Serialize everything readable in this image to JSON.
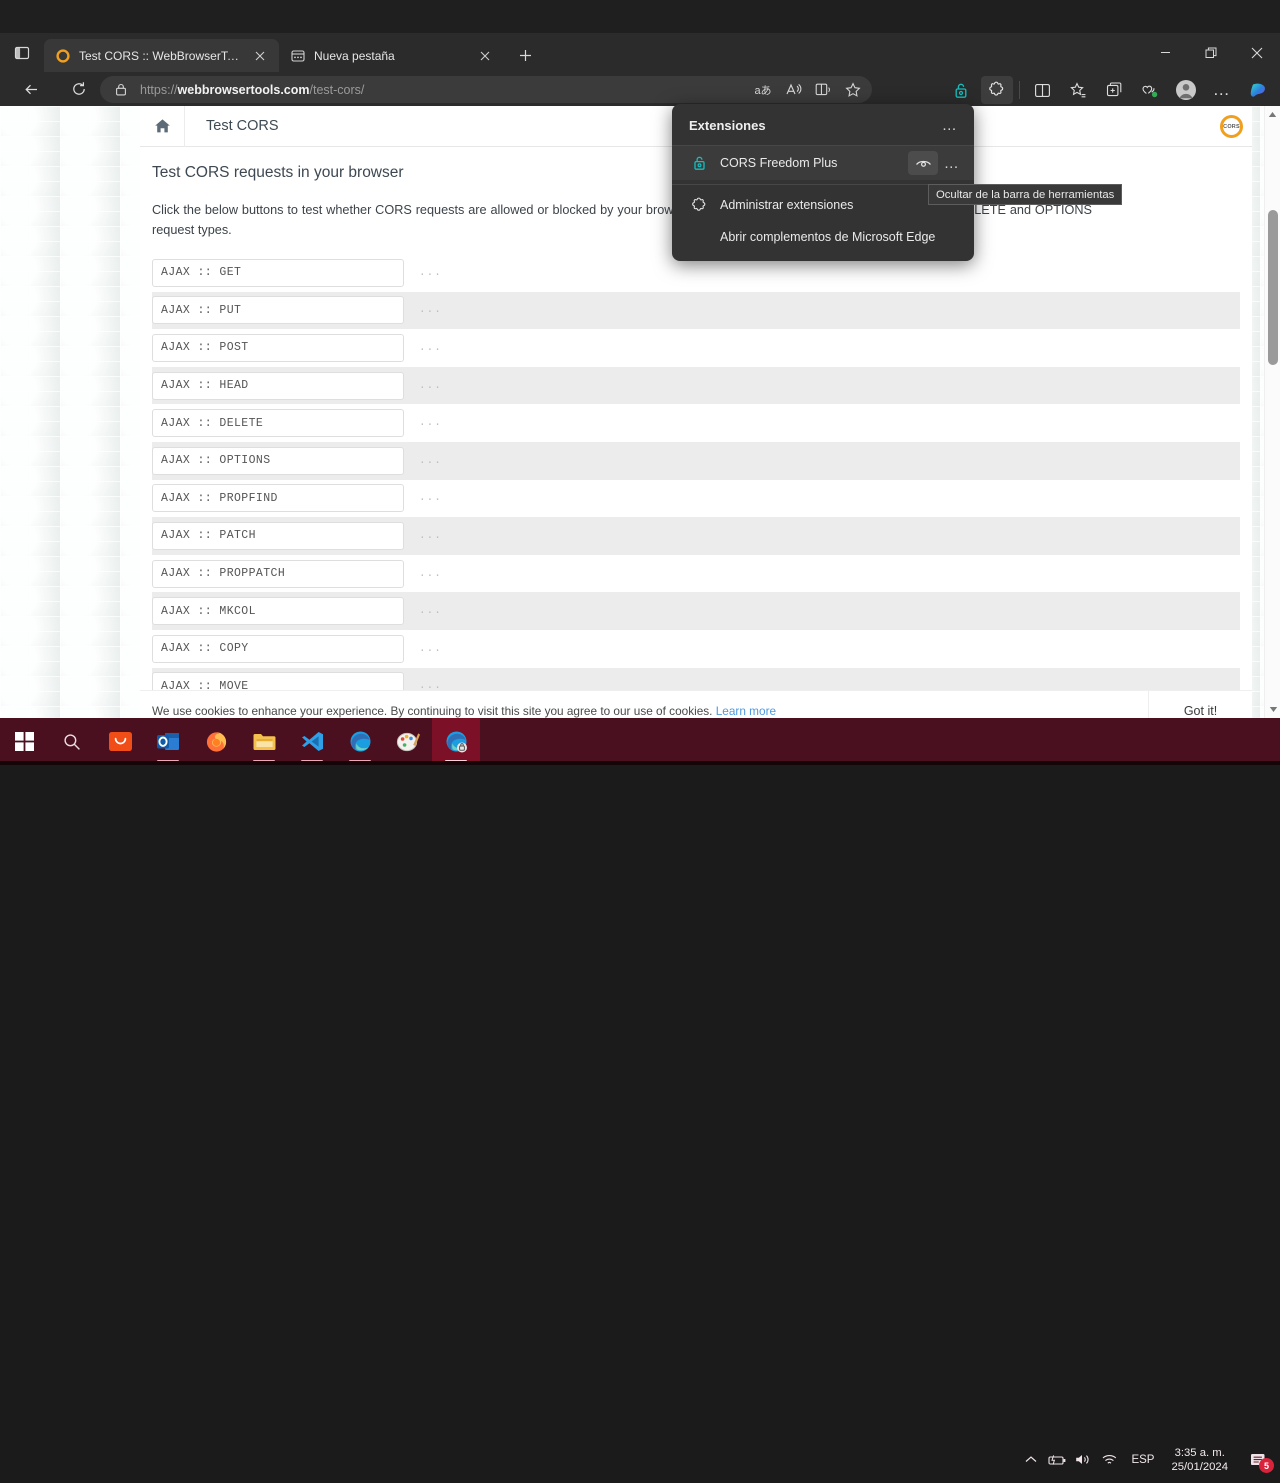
{
  "browser": {
    "tab_search_icon": "tab-search-icon",
    "tabs": [
      {
        "title": "Test CORS :: WebBrowserTools",
        "favicon": "cors-ring-favicon",
        "active": true
      },
      {
        "title": "Nueva pestaña",
        "favicon": "new-tab-page-icon",
        "active": false
      }
    ],
    "new_tab_label": "+",
    "window_controls": {
      "minimize": "minimize-icon",
      "restore": "restore-icon",
      "close": "close-icon"
    },
    "nav": {
      "back": "back-arrow-icon",
      "refresh": "refresh-icon"
    },
    "omnibox": {
      "lock_icon": "lock-icon",
      "url_scheme": "https://",
      "url_domain": "webbrowsertools.com",
      "url_path": "/test-cors/",
      "actions": [
        "translate-icon",
        "read-aloud-icon",
        "immersive-reader-icon",
        "add-favorite-icon"
      ]
    },
    "toolbar_right": [
      {
        "name": "cors-freedom-plus-extension-icon",
        "label": "CORS Freedom Plus"
      },
      {
        "name": "extensions-puzzle-icon",
        "label": "Extensiones"
      },
      {
        "name": "split-screen-icon",
        "label": "Pantalla dividida"
      },
      {
        "name": "collections-icon",
        "label": "Colecciones"
      },
      {
        "name": "browser-essentials-icon",
        "label": "Elementos esenciales del explorador"
      },
      {
        "name": "profile-avatar-icon",
        "label": "Perfil"
      },
      {
        "name": "settings-more-icon",
        "label": "Configuración y más"
      },
      {
        "name": "copilot-icon",
        "label": "Copilot"
      }
    ]
  },
  "extensions_panel": {
    "title": "Extensiones",
    "header_more": "…",
    "items": [
      {
        "label": "CORS Freedom Plus",
        "icon": "teal-padlock-icon",
        "eye_icon": "hide-eye-icon",
        "more": "…"
      }
    ],
    "manage_label": "Administrar extensiones",
    "manage_icon": "puzzle-piece-icon",
    "store_label": "Abrir complementos de Microsoft Edge",
    "tooltip": "Ocultar de la barra de herramientas"
  },
  "page": {
    "home_icon": "home-icon",
    "header_title": "Test CORS",
    "logo_text": "CORS",
    "heading": "Test CORS requests in your browser",
    "intro": "Click the below buttons to test whether CORS requests are allowed or blocked by your browser. This page supports GET, PUT, POST, HEAD, DELETE and OPTIONS request types.",
    "rows": [
      {
        "label": "AJAX :: GET",
        "status": "..."
      },
      {
        "label": "AJAX :: PUT",
        "status": "..."
      },
      {
        "label": "AJAX :: POST",
        "status": "..."
      },
      {
        "label": "AJAX :: HEAD",
        "status": "..."
      },
      {
        "label": "AJAX :: DELETE",
        "status": "..."
      },
      {
        "label": "AJAX :: OPTIONS",
        "status": "..."
      },
      {
        "label": "AJAX :: PROPFIND",
        "status": "..."
      },
      {
        "label": "AJAX :: PATCH",
        "status": "..."
      },
      {
        "label": "AJAX :: PROPPATCH",
        "status": "..."
      },
      {
        "label": "AJAX :: MKCOL",
        "status": "..."
      },
      {
        "label": "AJAX :: COPY",
        "status": "..."
      },
      {
        "label": "AJAX :: MOVE",
        "status": "..."
      }
    ],
    "cookie": {
      "text": "We use cookies to enhance your experience. By continuing to visit this site you agree to our use of cookies.",
      "link": "Learn more",
      "button": "Got it!"
    }
  },
  "taskbar": {
    "items": [
      {
        "name": "start-button",
        "icon": "windows-logo-icon"
      },
      {
        "name": "search-button",
        "icon": "search-icon"
      },
      {
        "name": "taskbar-shopping-app",
        "icon": "orange-bag-icon"
      },
      {
        "name": "taskbar-outlook",
        "icon": "outlook-icon"
      },
      {
        "name": "taskbar-firefox",
        "icon": "firefox-icon"
      },
      {
        "name": "taskbar-file-explorer",
        "icon": "folder-icon"
      },
      {
        "name": "taskbar-vscode",
        "icon": "vscode-icon"
      },
      {
        "name": "taskbar-edge",
        "icon": "edge-icon"
      },
      {
        "name": "taskbar-paint",
        "icon": "paint-icon"
      },
      {
        "name": "taskbar-edge-active",
        "icon": "edge-icon"
      }
    ],
    "tray": {
      "chevron": "chevron-up-icon",
      "battery": "battery-icon",
      "volume": "volume-icon",
      "wifi": "wifi-icon",
      "language": "ESP",
      "time": "3:35 a. m.",
      "date": "25/01/2024",
      "notifications_count": "5"
    }
  },
  "colors": {
    "accent_orange": "#f0a01e",
    "chrome_bg": "#2b2b2b",
    "taskbar_bg": "#4a1020",
    "extension_teal": "#17a3a3",
    "link_blue": "#4e9ae0"
  }
}
